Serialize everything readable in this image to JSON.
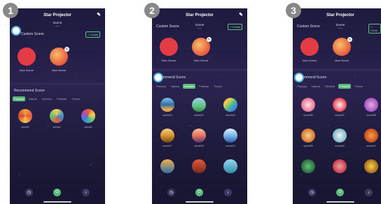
{
  "screens": [
    {
      "step": "1",
      "title": "Star Projector",
      "custom_scene": "Custom Scene",
      "scene_label": "Scene",
      "scene_value": "----",
      "create": "+ Create",
      "new_scene_1": "New Scene",
      "new_scene_2": "New Scene",
      "recommend": "Recommend Scene",
      "tabs": [
        "Passion",
        "Nature",
        "Mentive",
        "Festival",
        "Theme"
      ],
      "active_tab": 0,
      "scenes": [
        "scene0",
        "scene1",
        "scene2"
      ]
    },
    {
      "step": "2",
      "title": "Star Projector",
      "custom_scene": "Custom Scene",
      "scene_label": "Scene",
      "scene_value": "----",
      "create": "+ Create",
      "new_scene_1": "New Scene",
      "new_scene_2": "New Scene",
      "recommend": "mmend Scene",
      "tabs": [
        "Passion",
        "Nature",
        "Mentive",
        "Festival",
        "Theme"
      ],
      "active_tab": 2,
      "scenes": [
        "scene14",
        "scene15",
        "scene16",
        "scene17",
        "scene18",
        "scene19"
      ]
    },
    {
      "step": "3",
      "title": "Star Projector",
      "custom_scene": "Custom Scene",
      "scene_label": "Scene",
      "scene_value": "----",
      "create": "+ Creat",
      "new_scene_1": "New Scene",
      "new_scene_2": "New Scene",
      "recommend": "mmend Scene",
      "tabs": [
        "Passion",
        "Nature",
        "Mentive",
        "Festival",
        "Theme"
      ],
      "active_tab": 3,
      "scenes": [
        "scene36",
        "scene37",
        "scene38",
        "scene39",
        "scene40",
        "scene41"
      ]
    }
  ],
  "colors": {
    "accent": "#58b97a",
    "alexa": "#4fb3e6"
  }
}
